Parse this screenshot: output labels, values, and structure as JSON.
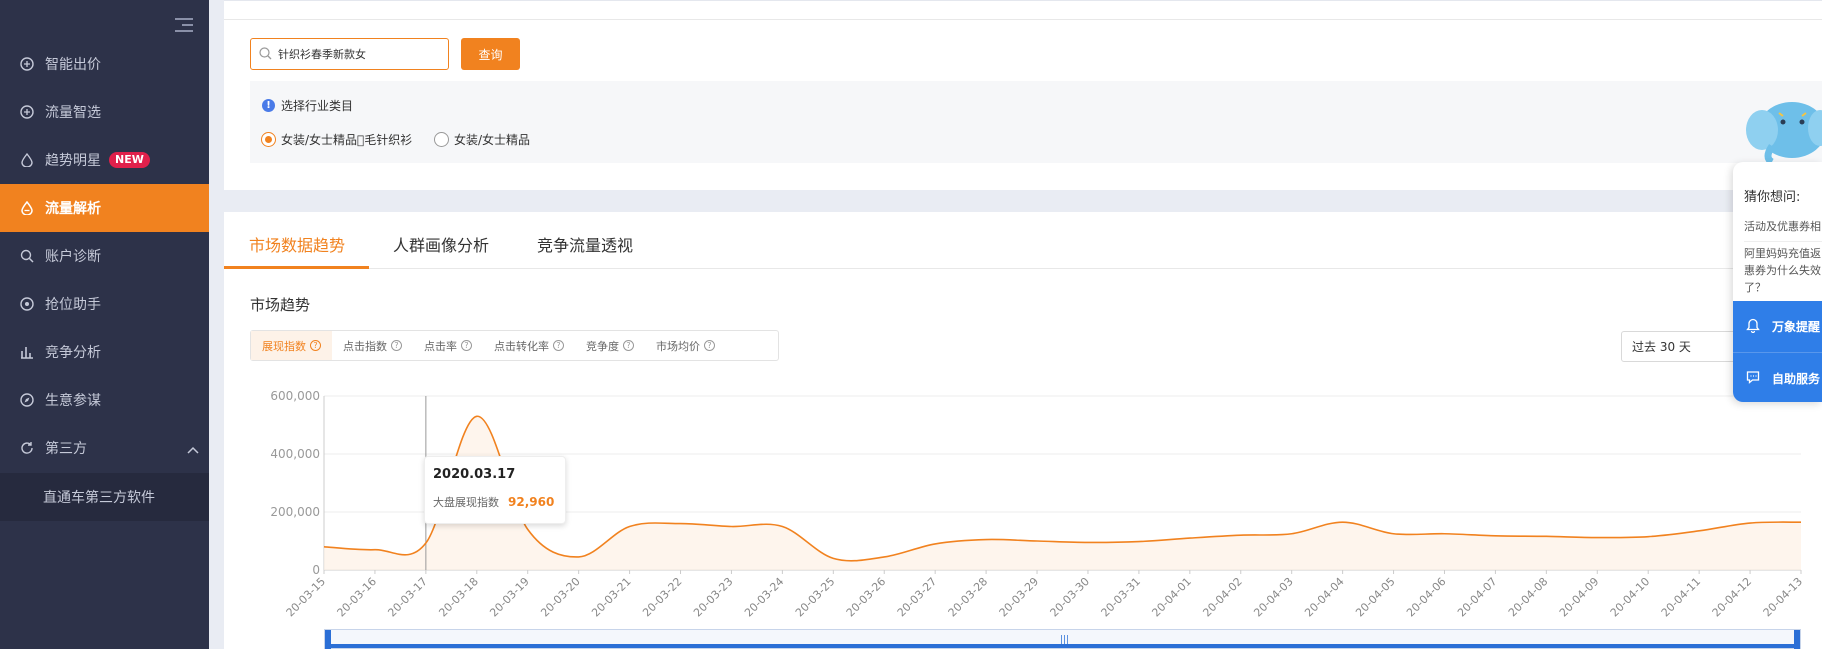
{
  "sidebar": {
    "items": [
      {
        "label": "智能出价"
      },
      {
        "label": "流量智选"
      },
      {
        "label": "趋势明星",
        "badge": "NEW"
      },
      {
        "label": "流量解析"
      },
      {
        "label": "账户诊断"
      },
      {
        "label": "抢位助手"
      },
      {
        "label": "竞争分析"
      },
      {
        "label": "生意参谋"
      },
      {
        "label": "第三方"
      }
    ],
    "sub_item": "直通车第三方软件"
  },
  "search": {
    "value": "针织衫春季新款女",
    "button": "查询"
  },
  "industry": {
    "label": "选择行业类目",
    "options": [
      "女装/女士精品\u0000毛针织衫",
      "女装/女士精品"
    ]
  },
  "tabs": [
    "市场数据趋势",
    "人群画像分析",
    "竞争流量透视"
  ],
  "section_title": "市场趋势",
  "metrics": [
    "展现指数",
    "点击指数",
    "点击率",
    "点击转化率",
    "竞争度",
    "市场均价"
  ],
  "range": "过去 30 天",
  "tooltip": {
    "date": "2020.03.17",
    "label": "大盘展现指数",
    "value": "92,960"
  },
  "helper": {
    "title": "猜你想问:",
    "q1": "活动及优惠券相",
    "q2_lines": [
      "阿里妈妈充值返",
      "惠券为什么失效",
      "了？"
    ],
    "btn1": "万象提醒",
    "btn2": "自助服务"
  },
  "chart_data": {
    "type": "area",
    "x": [
      "20-03-15",
      "20-03-16",
      "20-03-17",
      "20-03-18",
      "20-03-19",
      "20-03-20",
      "20-03-21",
      "20-03-22",
      "20-03-23",
      "20-03-24",
      "20-03-25",
      "20-03-26",
      "20-03-27",
      "20-03-28",
      "20-03-29",
      "20-03-30",
      "20-03-31",
      "20-04-01",
      "20-04-02",
      "20-04-03",
      "20-04-04",
      "20-04-05",
      "20-04-06",
      "20-04-07",
      "20-04-08",
      "20-04-09",
      "20-04-10",
      "20-04-11",
      "20-04-12",
      "20-04-13"
    ],
    "series": [
      {
        "values": [
          80000,
          70000,
          92960,
          530000,
          140000,
          45000,
          150000,
          160000,
          150000,
          150000,
          40000,
          45000,
          90000,
          105000,
          100000,
          95000,
          98000,
          110000,
          120000,
          125000,
          165000,
          125000,
          125000,
          118000,
          116000,
          112000,
          115000,
          135000,
          162000,
          165000
        ]
      }
    ],
    "yticks": [
      "0",
      "200,000",
      "400,000",
      "600,000"
    ],
    "ylim": [
      0,
      600000
    ],
    "grid": true,
    "color": "#f1821f"
  }
}
